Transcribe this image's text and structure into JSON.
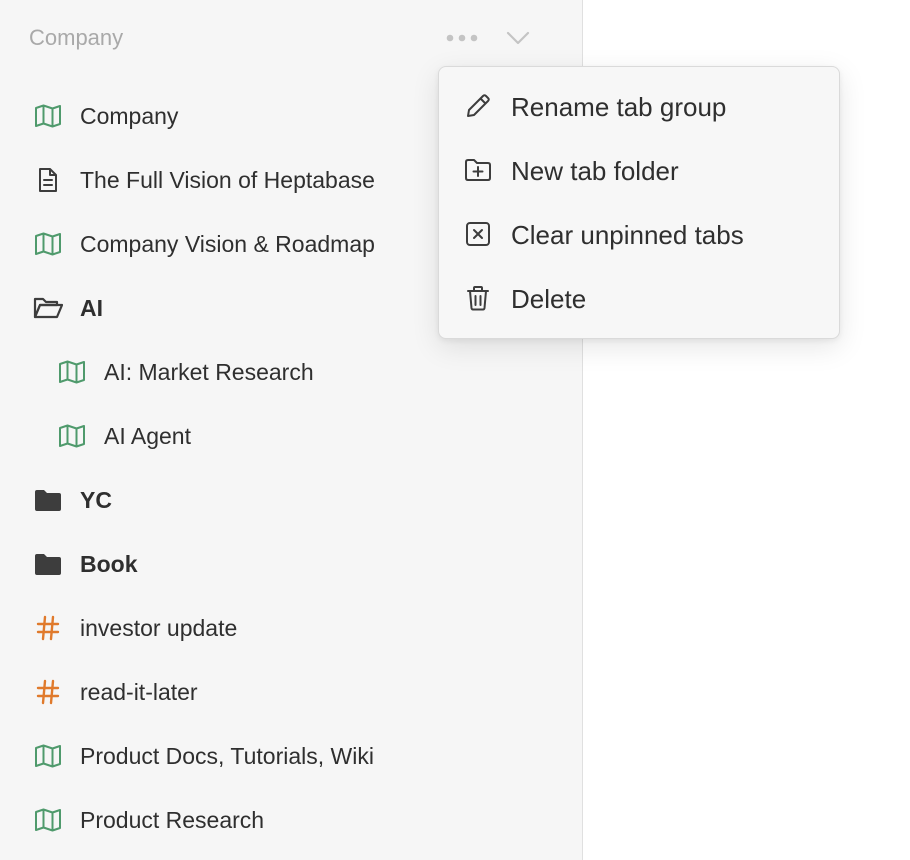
{
  "sidebar": {
    "header": {
      "title": "Company"
    },
    "items": [
      {
        "label": "Company",
        "icon": "whiteboard-map-icon"
      },
      {
        "label": "The Full Vision of Heptabase",
        "icon": "document-icon"
      },
      {
        "label": "Company Vision & Roadmap",
        "icon": "whiteboard-map-icon"
      },
      {
        "label": "AI",
        "icon": "folder-open-icon"
      },
      {
        "label": "AI: Market Research",
        "icon": "whiteboard-map-icon"
      },
      {
        "label": "AI Agent",
        "icon": "whiteboard-map-icon"
      },
      {
        "label": "YC",
        "icon": "folder-icon"
      },
      {
        "label": "Book",
        "icon": "folder-icon"
      },
      {
        "label": "investor update",
        "icon": "hash-tag-icon"
      },
      {
        "label": "read-it-later",
        "icon": "hash-tag-icon"
      },
      {
        "label": "Product Docs, Tutorials, Wiki",
        "icon": "whiteboard-map-icon"
      },
      {
        "label": "Product Research",
        "icon": "whiteboard-map-icon"
      }
    ]
  },
  "context_menu": {
    "items": [
      {
        "label": "Rename tab group",
        "icon": "pencil-icon"
      },
      {
        "label": "New tab folder",
        "icon": "folder-plus-icon"
      },
      {
        "label": "Clear unpinned tabs",
        "icon": "x-square-icon"
      },
      {
        "label": "Delete",
        "icon": "trash-icon"
      }
    ]
  },
  "colors": {
    "sidebar_bg": "#f6f6f6",
    "whiteboard_icon": "#4f9a6c",
    "tag_icon": "#e07a2c",
    "folder_icon": "#3d3d3d",
    "header_text": "#a9a9a9"
  }
}
